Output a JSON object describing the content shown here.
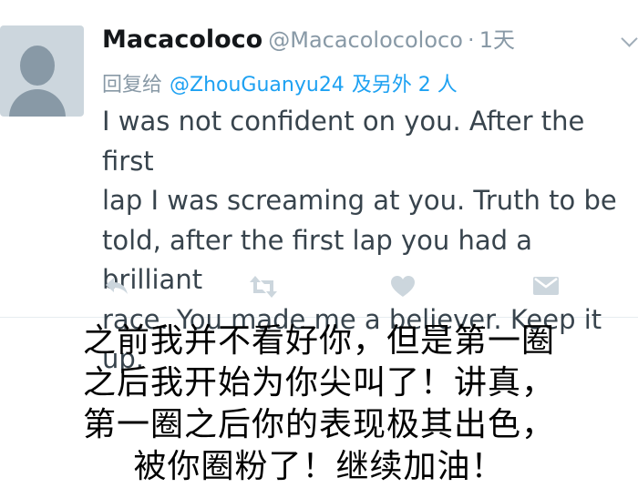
{
  "tweet": {
    "display_name": "Macacoloco",
    "handle": "@Macacolocoloco",
    "separator": "·",
    "time": "1天",
    "reply_prefix": "回复给",
    "reply_to": "@ZhouGuanyu24",
    "reply_others": "及另外 2 人",
    "text": "I was not confident on you. After the first\nlap I was  screaming at you. Truth to be\ntold, after the first lap you had a brilliant\nrace. You made me a believer. Keep it up.",
    "actions": [
      {
        "icon": "reply-icon"
      },
      {
        "icon": "retweet-icon"
      },
      {
        "icon": "like-heart-icon"
      },
      {
        "icon": "direct-message-icon"
      }
    ],
    "icon_color": "#ccd6dd",
    "link_color": "#1da1f2"
  },
  "caption": {
    "text": "之前我并不看好你，但是第一圈\n之后我开始为你尖叫了！讲真，\n第一圈之后你的表现极其出色，\n被你圈粉了！继续加油！"
  }
}
